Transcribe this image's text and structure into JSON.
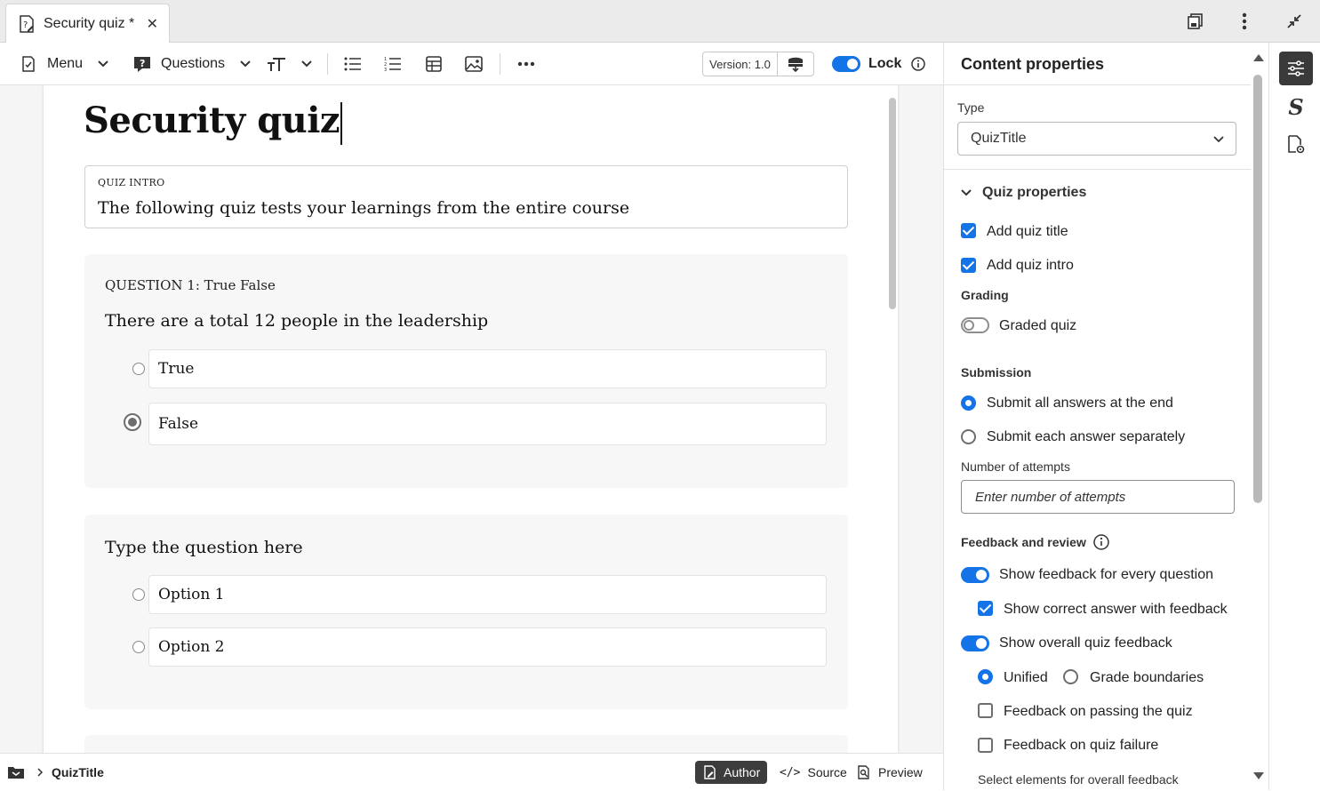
{
  "tab": {
    "title": "Security quiz *",
    "close": "✕"
  },
  "toolbar": {
    "menu_label": "Menu",
    "questions_label": "Questions",
    "version_label": "Version: 1.0",
    "lock_label": "Lock",
    "lock_on": true
  },
  "document": {
    "title": "Security quiz",
    "intro_label": "QUIZ INTRO",
    "intro_text": "The following quiz tests your learnings from the entire course",
    "questions": [
      {
        "header": "QUESTION 1: True False",
        "text": "There are a total 12 people in the leadership",
        "options": [
          {
            "label": "True",
            "selected": false
          },
          {
            "label": "False",
            "selected": true
          }
        ]
      },
      {
        "header": "",
        "text": "Type the question here",
        "options": [
          {
            "label": "Option 1",
            "selected": false
          },
          {
            "label": "Option 2",
            "selected": false
          }
        ]
      }
    ]
  },
  "statusbar": {
    "breadcrumb": "QuizTitle",
    "modes": {
      "author": "Author",
      "source": "Source",
      "preview": "Preview"
    },
    "active_mode": "Author"
  },
  "panel": {
    "title": "Content properties",
    "type_label": "Type",
    "type_value": "QuizTitle",
    "quiz_section": "Quiz properties",
    "add_title": {
      "label": "Add quiz title",
      "checked": true
    },
    "add_intro": {
      "label": "Add quiz intro",
      "checked": true
    },
    "grading_label": "Grading",
    "graded": {
      "label": "Graded quiz",
      "on": false
    },
    "submission_label": "Submission",
    "submit_end": {
      "label": "Submit all answers at the end",
      "selected": true
    },
    "submit_each": {
      "label": "Submit each answer separately",
      "selected": false
    },
    "attempts_label": "Number of attempts",
    "attempts_placeholder": "Enter number of attempts",
    "feedback_label": "Feedback and review",
    "feedback_every": {
      "label": "Show feedback for every question",
      "on": true
    },
    "correct_answer": {
      "label": "Show correct answer with feedback",
      "checked": true
    },
    "overall_feedback": {
      "label": "Show overall quiz feedback",
      "on": true
    },
    "unified": {
      "label": "Unified",
      "selected": true
    },
    "grade_boundaries": {
      "label": "Grade boundaries",
      "selected": false
    },
    "feedback_pass": {
      "label": "Feedback on passing the quiz",
      "checked": false
    },
    "feedback_fail": {
      "label": "Feedback on quiz failure",
      "checked": false
    },
    "select_elements": "Select elements for overall feedback"
  },
  "colors": {
    "accent": "#1473e6",
    "dark": "#3a3a3a"
  }
}
